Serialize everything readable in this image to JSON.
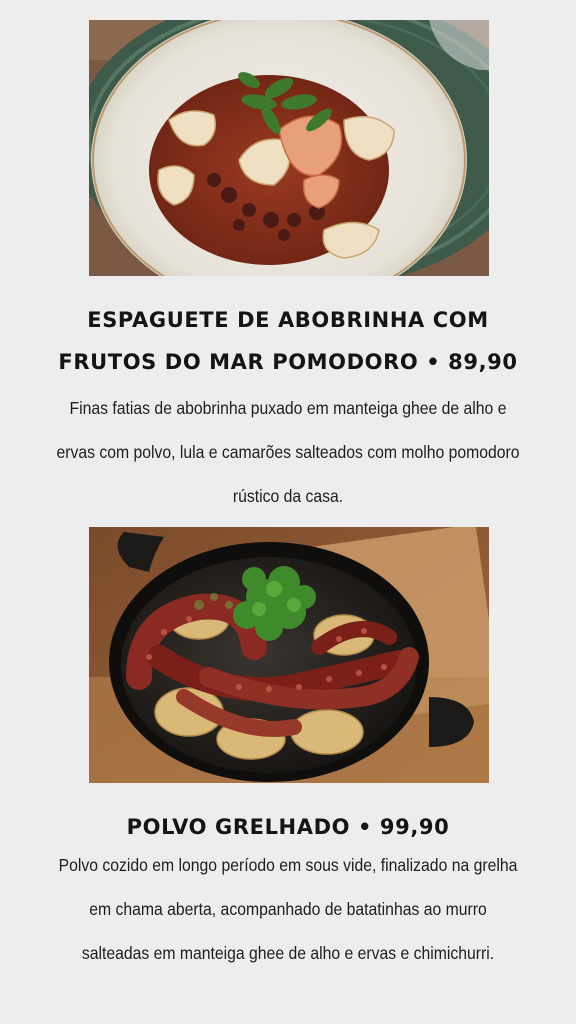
{
  "menu": {
    "items": [
      {
        "photo_alt": "Espaguete de abobrinha com frutos do mar pomodoro",
        "title": "ESPAGUETE DE ABOBRINHA COM FRUTOS DO MAR POMODORO • 89,90",
        "description": "Finas fatias de abobrinha puxado em manteiga ghee de alho e ervas com polvo, lula e camarões salteados com molho pomodoro rústico da casa."
      },
      {
        "photo_alt": "Polvo grelhado",
        "title": "POLVO GRELHADO • 99,90",
        "description": "Polvo cozido em longo período em sous vide, finalizado na grelha em chama aberta, acompanhado de batatinhas ao murro salteadas em manteiga ghee de alho e ervas e chimichurri."
      }
    ]
  },
  "colors": {
    "background": "#ededed",
    "text": "#141414"
  }
}
